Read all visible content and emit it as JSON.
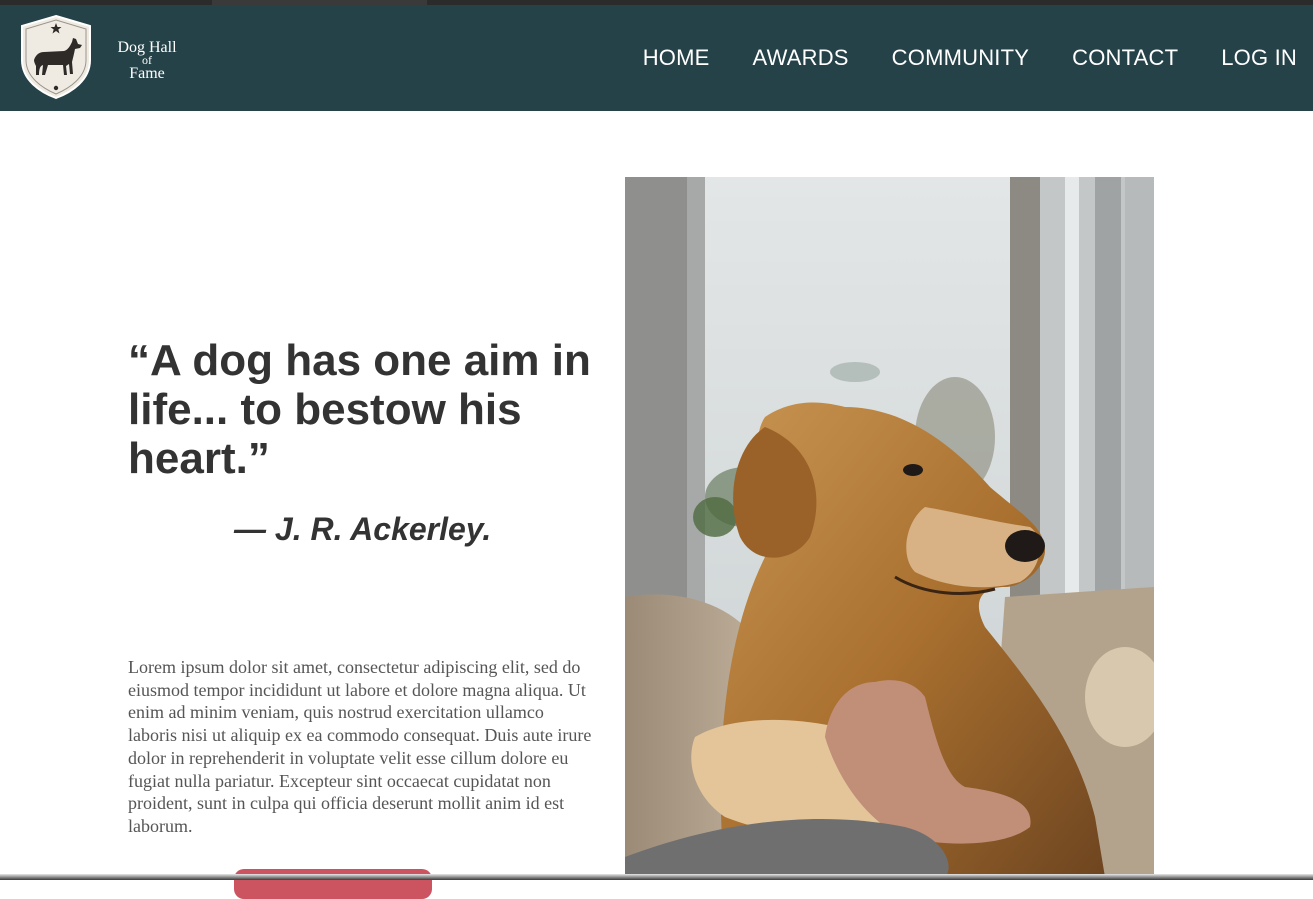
{
  "logo": {
    "line1": "Dog Hall",
    "line2": "of",
    "line3": "Fame",
    "icon": "dog-shield-icon"
  },
  "nav": {
    "items": [
      {
        "label": "HOME"
      },
      {
        "label": "AWARDS"
      },
      {
        "label": "COMMUNITY"
      },
      {
        "label": "CONTACT"
      },
      {
        "label": "LOG IN"
      }
    ]
  },
  "hero": {
    "quote": "“A dog has one aim in life... to bestow his heart.”",
    "author": "— J. R. Ackerley.",
    "body": "Lorem ipsum dolor sit amet, consectetur adipiscing elit, sed do eiusmod tempor incididunt ut labore et dolore magna aliqua. Ut enim ad minim veniam, quis nostrud exercitation ullamco laboris nisi ut aliquip ex ea commodo consequat. Duis aute irure dolor in reprehenderit in voluptate velit esse cillum dolore eu fugiat nulla pariatur. Excepteur sint occaecat cupidatat non proident, sunt in culpa qui officia deserunt mollit anim id est laborum.",
    "cta_label": "",
    "image": "golden-retriever-photo"
  },
  "colors": {
    "navbar": "#254249",
    "text_dark": "#333333",
    "text_body": "#555555",
    "cta": "#cc5460"
  }
}
